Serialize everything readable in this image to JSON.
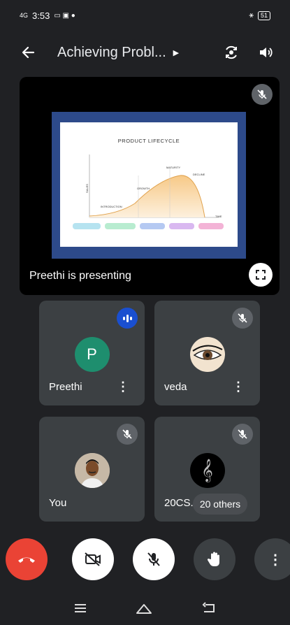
{
  "status": {
    "time": "3:53",
    "signal": "4G",
    "battery": "51"
  },
  "header": {
    "title": "Achieving Probl...",
    "back_icon": "back-arrow-icon",
    "switch_camera_icon": "switch-camera-icon",
    "speaker_icon": "speaker-icon"
  },
  "presentation": {
    "caption": "Preethi is presenting",
    "slide": {
      "title": "PRODUCT LIFECYCLE",
      "stages": [
        "INTRODUCTION",
        "GROWTH",
        "MATURITY",
        "DECLINE"
      ],
      "axis_y": "SALES",
      "axis_x": "TIME"
    }
  },
  "participants": [
    {
      "name": "Preethi",
      "initial": "P",
      "status": "speaking",
      "avatar_color": "#1e8e6e"
    },
    {
      "name": "veda",
      "status": "muted"
    },
    {
      "name": "You",
      "status": "muted"
    },
    {
      "name": "20CS...",
      "status": "muted"
    }
  ],
  "others_label": "20 others",
  "controls": {
    "end_call": "End call",
    "camera": "Camera off",
    "mic": "Mic off",
    "raise_hand": "Raise hand",
    "more": "More options"
  },
  "colors": {
    "background": "#202124",
    "tile": "#3c4043",
    "end_call": "#ea4335",
    "speaking": "#1a4fd0"
  }
}
